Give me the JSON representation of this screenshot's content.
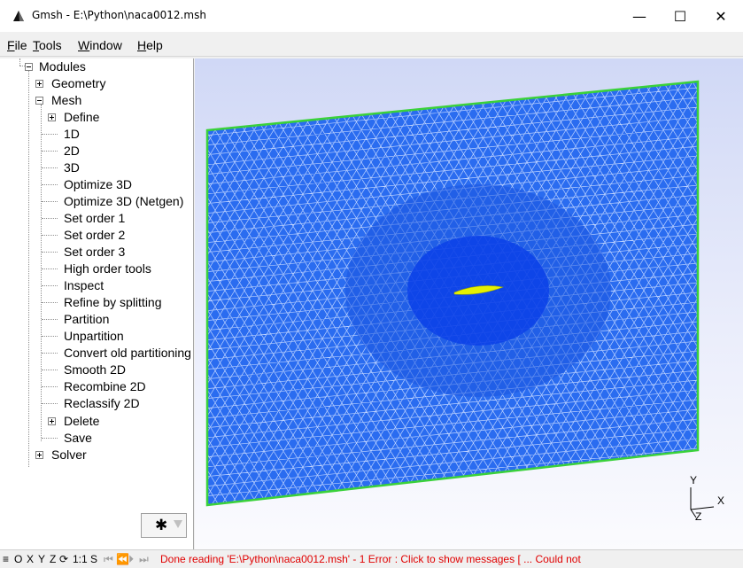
{
  "window": {
    "title": "Gmsh - E:\\Python\\naca0012.msh",
    "minimize": "—",
    "maximize": "☐",
    "close": "✕"
  },
  "menu": [
    "File",
    "Tools",
    "Window",
    "Help"
  ],
  "menu_underline": [
    "F",
    "T",
    "W",
    "H"
  ],
  "tree": {
    "root": "Modules",
    "geometry": "Geometry",
    "mesh": "Mesh",
    "define": "Define",
    "mesh_items": [
      "1D",
      "2D",
      "3D",
      "Optimize 3D",
      "Optimize 3D (Netgen)",
      "Set order 1",
      "Set order 2",
      "Set order 3",
      "High order tools",
      "Inspect",
      "Refine by splitting",
      "Partition",
      "Unpartition",
      "Convert old partitioning",
      "Smooth 2D",
      "Recombine 2D",
      "Reclassify 2D"
    ],
    "delete": "Delete",
    "save": "Save",
    "solver": "Solver"
  },
  "gear_icon": "gear-icon",
  "axes": {
    "y": "Y",
    "x": "X",
    "z": "Z"
  },
  "statusbar": {
    "menu_glyph": "≡",
    "views": [
      "O",
      "X",
      "Y",
      "Z"
    ],
    "rotate_glyph": "⟳",
    "scale": "1:1",
    "s": "S",
    "anim": [
      "⏮",
      "⏪",
      "⏵",
      "⏭"
    ],
    "message": "Done reading 'E:\\Python\\naca0012.msh'  -  1 Error : Click to show messages [ ... Could not"
  },
  "colors": {
    "mesh_edges": "#1a55e0",
    "boundary": "#3ad13a",
    "airfoil": "#e6f000",
    "status_message": "#e00000"
  }
}
